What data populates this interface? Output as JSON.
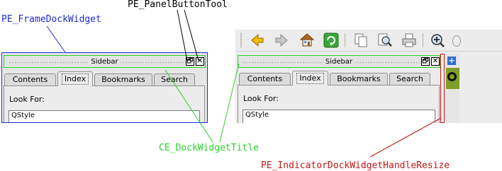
{
  "annotations": {
    "panel_button_tool": "PE_PanelButtonTool",
    "frame_dock_widget": "PE_FrameDockWidget",
    "dock_widget_title": "CE_DockWidgetTitle",
    "handle_resize": "PE_IndicatorDockWidgetHandleResize"
  },
  "dock": {
    "title": "Sidebar",
    "float_button": "🗗",
    "close_button": "✕",
    "tabs": [
      {
        "label": "Contents",
        "active": false
      },
      {
        "label": "Index",
        "active": true
      },
      {
        "label": "Bookmarks",
        "active": false
      },
      {
        "label": "Search",
        "active": false
      }
    ],
    "look_for_label": "Look For:",
    "search_value": "QStyle"
  },
  "toolbar_icons": [
    "back-icon",
    "forward-icon",
    "home-icon",
    "sync-icon",
    "copy-icon",
    "find-icon",
    "print-icon",
    "zoom-in-icon"
  ],
  "colors": {
    "frame": "#1f2bd6",
    "title": "#2ad12a",
    "resize": "#c41616",
    "button_tool": "#000000"
  }
}
